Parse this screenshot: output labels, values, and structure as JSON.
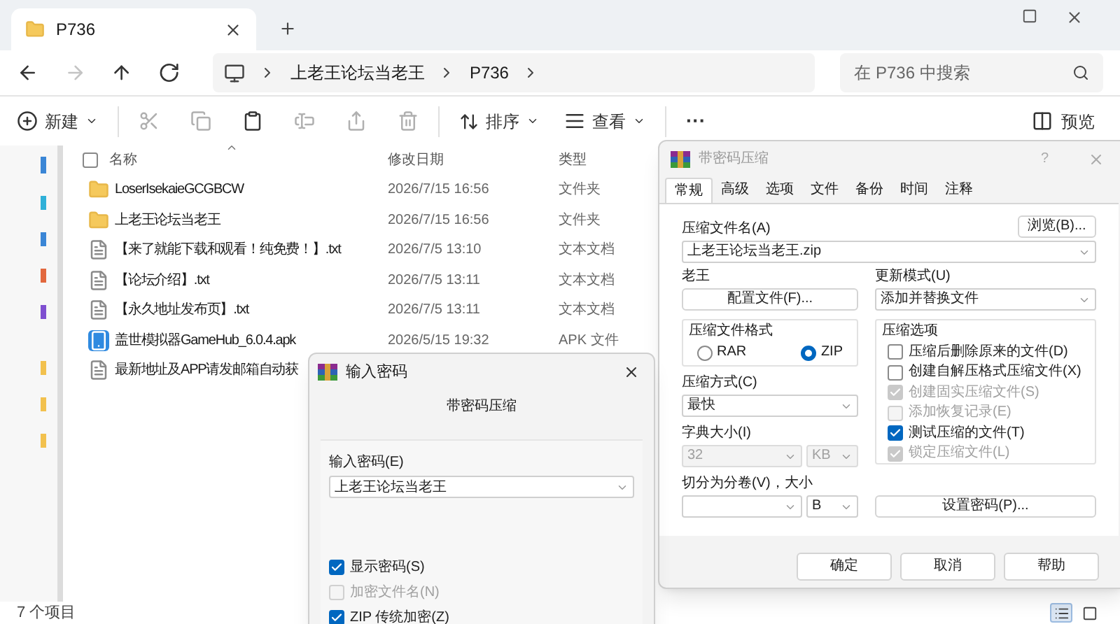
{
  "explorer": {
    "tab_title": "P736",
    "nav": [
      {
        "kind": "back",
        "disabled": false
      },
      {
        "kind": "forward",
        "disabled": true
      },
      {
        "kind": "up",
        "disabled": false
      },
      {
        "kind": "refresh",
        "disabled": false
      }
    ],
    "breadcrumb": [
      "上老王论坛当老王",
      "P736"
    ],
    "search": {
      "placeholder": "在 P736 中搜索"
    },
    "toolbar": {
      "new": "新建",
      "sort": "排序",
      "view": "查看",
      "more": "···",
      "preview": "预览"
    },
    "select_all": {
      "checked": false
    },
    "columns": [
      "名称",
      "修改日期",
      "类型"
    ],
    "files": [
      {
        "kind": "folder",
        "name": "LoserIsekaieGCGBCW",
        "date": "2026/7/15 16:56",
        "type": "文件夹"
      },
      {
        "kind": "folder",
        "name": "上老王论坛当老王",
        "date": "2026/7/15 16:56",
        "type": "文件夹"
      },
      {
        "kind": "text",
        "name": "【来了就能下载和观看！纯免费！】.txt",
        "date": "2026/7/5 13:10",
        "type": "文本文档"
      },
      {
        "kind": "text",
        "name": "【论坛介绍】.txt",
        "date": "2026/7/5 13:11",
        "type": "文本文档"
      },
      {
        "kind": "text",
        "name": "【永久地址发布页】.txt",
        "date": "2026/7/5 13:11",
        "type": "文本文档"
      },
      {
        "kind": "apk",
        "name": "盖世模拟器GameHub_6.0.4.apk",
        "date": "2026/5/15 19:32",
        "type": "APK 文件"
      },
      {
        "kind": "text",
        "name": "最新地址及APP请发邮箱自动获"
      }
    ],
    "status": "7 个项目",
    "view_buttons": [
      {
        "kind": "details",
        "selected": true
      },
      {
        "kind": "tiles",
        "selected": false
      }
    ]
  },
  "archive_dialog": {
    "title": "带密码压缩",
    "help": "?",
    "tabs": [
      {
        "label": "常规",
        "selected": true
      },
      {
        "label": "高级",
        "selected": false
      },
      {
        "label": "选项",
        "selected": false
      },
      {
        "label": "文件",
        "selected": false
      },
      {
        "label": "备份",
        "selected": false
      },
      {
        "label": "时间",
        "selected": false
      },
      {
        "label": "注释",
        "selected": false
      }
    ],
    "archive_name": {
      "label": "压缩文件名(A)",
      "value": "上老王论坛当老王.zip"
    },
    "browse": "浏览(B)...",
    "profile": {
      "label": "老王",
      "button": "配置文件(F)..."
    },
    "update_mode": {
      "label": "更新模式(U)",
      "value": "添加并替换文件"
    },
    "format": {
      "label": "压缩文件格式",
      "options": [
        {
          "label": "RAR",
          "selected": false
        },
        {
          "label": "ZIP",
          "selected": true
        }
      ]
    },
    "method": {
      "label": "压缩方式(C)",
      "value": "最快"
    },
    "dictionary": {
      "label": "字典大小(I)",
      "value": "32",
      "unit": "KB",
      "disabled": true
    },
    "split": {
      "label": "切分为分卷(V)，大小",
      "unit": "B"
    },
    "options": {
      "label": "压缩选项",
      "items": [
        {
          "label": "压缩后删除原来的文件(D)",
          "checked": false,
          "disabled": false
        },
        {
          "label": "创建自解压格式压缩文件(X)",
          "checked": false,
          "disabled": false
        },
        {
          "label": "创建固实压缩文件(S)",
          "checked": true,
          "disabled": true
        },
        {
          "label": "添加恢复记录(E)",
          "checked": false,
          "disabled": true
        },
        {
          "label": "测试压缩的文件(T)",
          "checked": true,
          "disabled": false
        },
        {
          "label": "锁定压缩文件(L)",
          "checked": true,
          "disabled": true
        }
      ]
    },
    "set_password": "设置密码(P)...",
    "buttons": [
      "确定",
      "取消",
      "帮助"
    ]
  },
  "password_dialog": {
    "title": "输入密码",
    "subtitle": "带密码压缩",
    "field": {
      "label": "输入密码(E)",
      "value": "上老王论坛当老王"
    },
    "options": [
      {
        "label": "显示密码(S)",
        "checked": true,
        "disabled": false
      },
      {
        "label": "加密文件名(N)",
        "checked": false,
        "disabled": true
      },
      {
        "label": "ZIP 传统加密(Z)",
        "checked": true,
        "disabled": false
      }
    ]
  }
}
